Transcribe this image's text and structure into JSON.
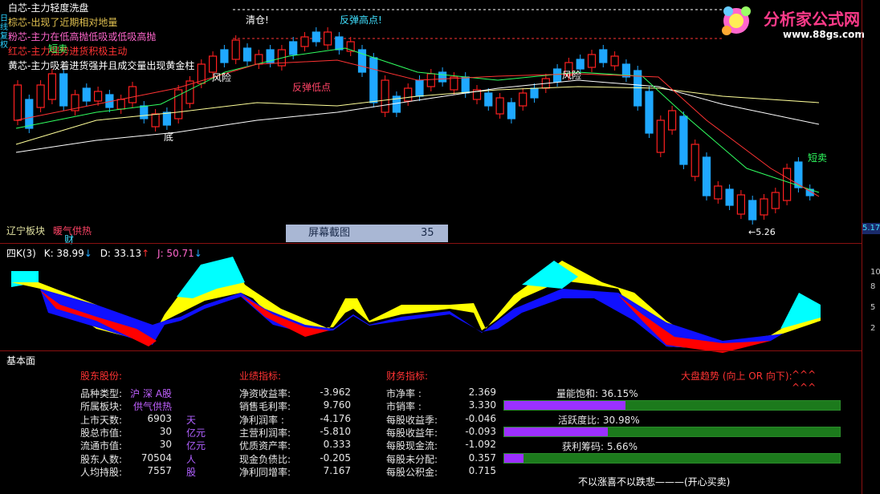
{
  "legend": [
    {
      "text": "白芯-主力轻度洗盘",
      "color": "#ffffff"
    },
    {
      "text": "棕芯-出现了近期相对地量",
      "color": "#e0c050"
    },
    {
      "text": "粉芯-主力在低高抛低吸或低吸高抛",
      "color": "#ff66cc"
    },
    {
      "text": "红芯-主力强势进货积极主动",
      "color": "#ff3333"
    },
    {
      "text": "黄芯-主力吸着进货强并且成交量出现黄金柱",
      "color": "#ffffff"
    }
  ],
  "side_label": "日线 复权 ",
  "annotations": {
    "qingcang": "清仓!",
    "fantan_gaodian": "反弹高点!",
    "duanmai1": "短卖",
    "fengxian1": "风险",
    "fengxian2": "风险",
    "fantan_didian": "反弹低点",
    "di": "底",
    "duanmai2": "短卖",
    "low_marker": "←5.26",
    "cai": "财"
  },
  "sector": {
    "name": "辽宁板块",
    "hot": "暖气供热"
  },
  "price_axis_value": "5.17",
  "capture": {
    "label": "屏幕截图",
    "number": "35"
  },
  "kdj": {
    "title": "四K(3)",
    "k": "K: 38.99",
    "d": "D: 33.13",
    "j": "J: 50.71",
    "axis": [
      "10",
      "8",
      "5",
      "2"
    ]
  },
  "fundamentals": {
    "section": "基本面",
    "shareholder": {
      "title": "股东股份:",
      "rows": [
        {
          "label": "品种类型:",
          "value": "沪 深 A股",
          "unit": ""
        },
        {
          "label": "所属板块:",
          "value": "供气供热",
          "unit": ""
        },
        {
          "label": "上市天数:",
          "value": "6903",
          "unit": "天"
        },
        {
          "label": "股总市值:",
          "value": "30",
          "unit": "亿元"
        },
        {
          "label": "流通市值:",
          "value": "30",
          "unit": "亿元"
        },
        {
          "label": "股东人数:",
          "value": "70504",
          "unit": "人"
        },
        {
          "label": "人均持股:",
          "value": "7557",
          "unit": "股"
        }
      ]
    },
    "performance": {
      "title": "业绩指标:",
      "rows": [
        {
          "label": "净资收益率:",
          "value": "-3.962"
        },
        {
          "label": "销售毛利率:",
          "value": "9.760"
        },
        {
          "label": "净利润率  :",
          "value": "-4.176"
        },
        {
          "label": "主营利润率:",
          "value": "-5.810"
        },
        {
          "label": "优质资产率:",
          "value": "0.333"
        },
        {
          "label": "现金负债比:",
          "value": "-0.205"
        },
        {
          "label": "净利同增率:",
          "value": "7.167"
        }
      ]
    },
    "finance": {
      "title": "财务指标:",
      "rows": [
        {
          "label": "市净率      :",
          "value": "2.369"
        },
        {
          "label": "市销率      :",
          "value": "3.330"
        },
        {
          "label": "每股收益季:",
          "value": "-0.046"
        },
        {
          "label": "每股收益年:",
          "value": "-0.093"
        },
        {
          "label": "每股现金流:",
          "value": "-1.092"
        },
        {
          "label": "每股未分配:",
          "value": "0.357"
        },
        {
          "label": "每股公积金:",
          "value": "0.715"
        }
      ]
    },
    "market": {
      "title": "大盘趋势 (向上 OR 向下):",
      "arrows1": "^^^",
      "arrows2": "^^^",
      "bars": [
        {
          "label": "量能饱和:  36.15%",
          "fraction": 0.3615
        },
        {
          "label": "活跃度比:  30.98%",
          "fraction": 0.3098
        },
        {
          "label": "获利筹码:  5.66%",
          "fraction": 0.0566
        }
      ],
      "footer": "不以涨喜不以跌悲———(开心买卖)"
    }
  },
  "logo": {
    "title": "分析家公式网",
    "url": "www.88gs.com"
  },
  "colors": {
    "up": "#ff2020",
    "down": "#1fa8ff",
    "kdj_cyan": "#00ffff",
    "kdj_yellow": "#ffff00",
    "kdj_blue": "#1010ff",
    "kdj_red": "#ff0000"
  }
}
